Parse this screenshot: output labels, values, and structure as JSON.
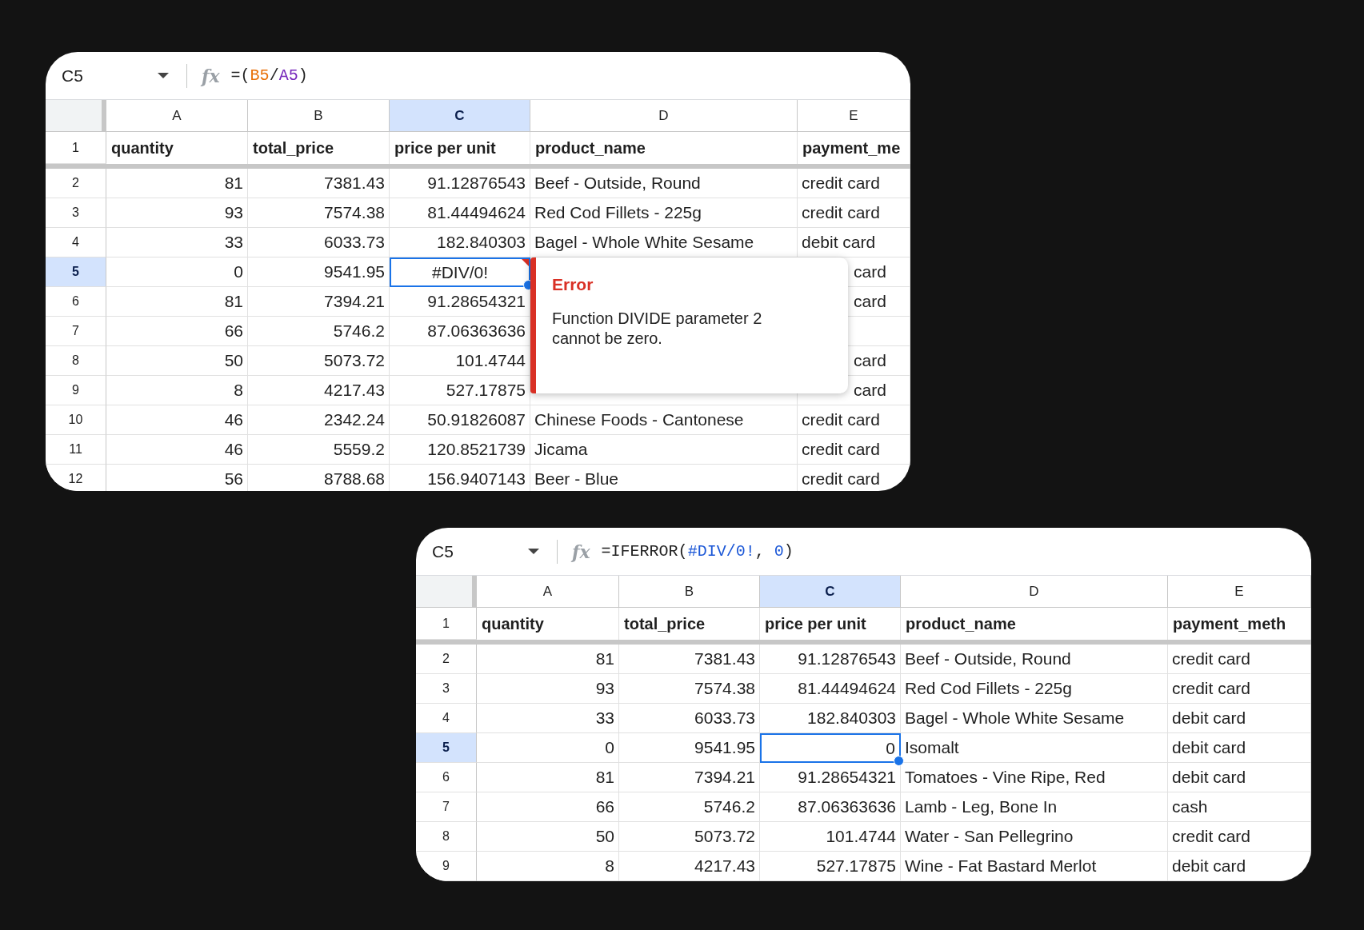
{
  "sheets": [
    {
      "name_box": "C5",
      "function_icon": "fx",
      "formula": [
        {
          "text": "=(",
          "color": "#1f1f1f"
        },
        {
          "text": "B5",
          "color": "#e8710a"
        },
        {
          "text": "/",
          "color": "#1f1f1f"
        },
        {
          "text": "A5",
          "color": "#7627bb"
        },
        {
          "text": ")",
          "color": "#1f1f1f"
        }
      ],
      "columns": [
        {
          "label": "A",
          "selected": false,
          "kind": "number"
        },
        {
          "label": "B",
          "selected": false,
          "kind": "number"
        },
        {
          "label": "C",
          "selected": true,
          "kind": "number"
        },
        {
          "label": "D",
          "selected": false,
          "kind": "text"
        },
        {
          "label": "E",
          "selected": false,
          "kind": "text"
        }
      ],
      "header_row": {
        "number": "1",
        "cells": [
          "quantity",
          "total_price",
          "price per unit",
          "product_name",
          "payment_me"
        ]
      },
      "rows": [
        {
          "number": "2",
          "selected": false,
          "cells": [
            {
              "text": "81",
              "selected": false
            },
            {
              "text": "7381.43",
              "selected": false
            },
            {
              "text": "91.12876543",
              "selected": false
            },
            {
              "text": "Beef - Outside, Round",
              "selected": false
            },
            {
              "text": "credit card",
              "selected": false
            }
          ]
        },
        {
          "number": "3",
          "selected": false,
          "cells": [
            {
              "text": "93",
              "selected": false
            },
            {
              "text": "7574.38",
              "selected": false
            },
            {
              "text": "81.44494624",
              "selected": false
            },
            {
              "text": "Red Cod Fillets - 225g",
              "selected": false
            },
            {
              "text": "credit card",
              "selected": false
            }
          ]
        },
        {
          "number": "4",
          "selected": false,
          "cells": [
            {
              "text": "33",
              "selected": false
            },
            {
              "text": "6033.73",
              "selected": false
            },
            {
              "text": "182.840303",
              "selected": false
            },
            {
              "text": "Bagel - Whole White Sesame",
              "selected": false
            },
            {
              "text": "debit card",
              "selected": false
            }
          ]
        },
        {
          "number": "5",
          "selected": true,
          "cells": [
            {
              "text": "0",
              "selected": false
            },
            {
              "text": "9541.95",
              "selected": false
            },
            {
              "text": "#DIV/0!",
              "selected": true,
              "kind": "error"
            },
            {},
            {
              "text": "card",
              "selected": false,
              "covered": true
            }
          ]
        },
        {
          "number": "6",
          "selected": false,
          "cells": [
            {
              "text": "81",
              "selected": false
            },
            {
              "text": "7394.21",
              "selected": false
            },
            {
              "text": "91.28654321",
              "selected": false
            },
            {},
            {
              "text": "card",
              "selected": false,
              "covered": true
            }
          ]
        },
        {
          "number": "7",
          "selected": false,
          "cells": [
            {
              "text": "66",
              "selected": false
            },
            {
              "text": "5746.2",
              "selected": false
            },
            {
              "text": "87.06363636",
              "selected": false
            },
            {},
            {
              "selected": false
            }
          ]
        },
        {
          "number": "8",
          "selected": false,
          "cells": [
            {
              "text": "50",
              "selected": false
            },
            {
              "text": "5073.72",
              "selected": false
            },
            {
              "text": "101.4744",
              "selected": false
            },
            {},
            {
              "text": "card",
              "selected": false,
              "covered": true
            }
          ]
        },
        {
          "number": "9",
          "selected": false,
          "cells": [
            {
              "text": "8",
              "selected": false
            },
            {
              "text": "4217.43",
              "selected": false
            },
            {
              "text": "527.17875",
              "selected": false
            },
            {},
            {
              "text": "card",
              "selected": false,
              "covered": true
            }
          ]
        },
        {
          "number": "10",
          "selected": false,
          "cells": [
            {
              "text": "46",
              "selected": false
            },
            {
              "text": "2342.24",
              "selected": false
            },
            {
              "text": "50.91826087",
              "selected": false
            },
            {
              "text": "Chinese Foods - Cantonese",
              "selected": false
            },
            {
              "text": "credit card",
              "selected": false
            }
          ]
        },
        {
          "number": "11",
          "selected": false,
          "cells": [
            {
              "text": "46",
              "selected": false
            },
            {
              "text": "5559.2",
              "selected": false
            },
            {
              "text": "120.8521739",
              "selected": false
            },
            {
              "text": "Jicama",
              "selected": false
            },
            {
              "text": "credit card",
              "selected": false
            }
          ]
        },
        {
          "number": "12",
          "selected": false,
          "cells": [
            {
              "text": "56",
              "selected": false
            },
            {
              "text": "8788.68",
              "selected": false
            },
            {
              "text": "156.9407143",
              "selected": false
            },
            {
              "text": "Beer - Blue",
              "selected": false
            },
            {
              "text": "credit card",
              "selected": false
            }
          ]
        }
      ],
      "tooltip": {
        "title": "Error",
        "message": "Function DIVIDE parameter 2 cannot be zero."
      }
    },
    {
      "name_box": "C5",
      "function_icon": "fx",
      "formula": [
        {
          "text": "=IFERROR(",
          "color": "#1f1f1f"
        },
        {
          "text": "#DIV/0!",
          "color": "#1a56d6"
        },
        {
          "text": ", ",
          "color": "#1f1f1f"
        },
        {
          "text": "0",
          "color": "#1a56d6"
        },
        {
          "text": ")",
          "color": "#1f1f1f"
        }
      ],
      "columns": [
        {
          "label": "A",
          "selected": false,
          "kind": "number"
        },
        {
          "label": "B",
          "selected": false,
          "kind": "number"
        },
        {
          "label": "C",
          "selected": true,
          "kind": "number"
        },
        {
          "label": "D",
          "selected": false,
          "kind": "text"
        },
        {
          "label": "E",
          "selected": false,
          "kind": "text"
        }
      ],
      "header_row": {
        "number": "1",
        "cells": [
          "quantity",
          "total_price",
          "price per unit",
          "product_name",
          "payment_meth"
        ]
      },
      "rows": [
        {
          "number": "2",
          "selected": false,
          "cells": [
            {
              "text": "81",
              "selected": false
            },
            {
              "text": "7381.43",
              "selected": false
            },
            {
              "text": "91.12876543",
              "selected": false
            },
            {
              "text": "Beef - Outside, Round",
              "selected": false
            },
            {
              "text": "credit card",
              "selected": false
            }
          ]
        },
        {
          "number": "3",
          "selected": false,
          "cells": [
            {
              "text": "93",
              "selected": false
            },
            {
              "text": "7574.38",
              "selected": false
            },
            {
              "text": "81.44494624",
              "selected": false
            },
            {
              "text": "Red Cod Fillets - 225g",
              "selected": false
            },
            {
              "text": "credit card",
              "selected": false
            }
          ]
        },
        {
          "number": "4",
          "selected": false,
          "cells": [
            {
              "text": "33",
              "selected": false
            },
            {
              "text": "6033.73",
              "selected": false
            },
            {
              "text": "182.840303",
              "selected": false
            },
            {
              "text": "Bagel - Whole White Sesame",
              "selected": false
            },
            {
              "text": "debit card",
              "selected": false
            }
          ]
        },
        {
          "number": "5",
          "selected": true,
          "cells": [
            {
              "text": "0",
              "selected": false
            },
            {
              "text": "9541.95",
              "selected": false
            },
            {
              "text": "0",
              "selected": true
            },
            {
              "text": "Isomalt",
              "selected": false
            },
            {
              "text": "debit card",
              "selected": false
            }
          ]
        },
        {
          "number": "6",
          "selected": false,
          "cells": [
            {
              "text": "81",
              "selected": false
            },
            {
              "text": "7394.21",
              "selected": false
            },
            {
              "text": "91.28654321",
              "selected": false
            },
            {
              "text": "Tomatoes - Vine Ripe, Red",
              "selected": false
            },
            {
              "text": "debit card",
              "selected": false
            }
          ]
        },
        {
          "number": "7",
          "selected": false,
          "cells": [
            {
              "text": "66",
              "selected": false
            },
            {
              "text": "5746.2",
              "selected": false
            },
            {
              "text": "87.06363636",
              "selected": false
            },
            {
              "text": "Lamb - Leg, Bone In",
              "selected": false
            },
            {
              "text": "cash",
              "selected": false
            }
          ]
        },
        {
          "number": "8",
          "selected": false,
          "cells": [
            {
              "text": "50",
              "selected": false
            },
            {
              "text": "5073.72",
              "selected": false
            },
            {
              "text": "101.4744",
              "selected": false
            },
            {
              "text": "Water - San Pellegrino",
              "selected": false
            },
            {
              "text": "credit card",
              "selected": false
            }
          ]
        },
        {
          "number": "9",
          "selected": false,
          "cells": [
            {
              "text": "8",
              "selected": false
            },
            {
              "text": "4217.43",
              "selected": false
            },
            {
              "text": "527.17875",
              "selected": false
            },
            {
              "text": "Wine - Fat Bastard Merlot",
              "selected": false
            },
            {
              "text": "debit card",
              "selected": false
            }
          ]
        }
      ]
    }
  ]
}
